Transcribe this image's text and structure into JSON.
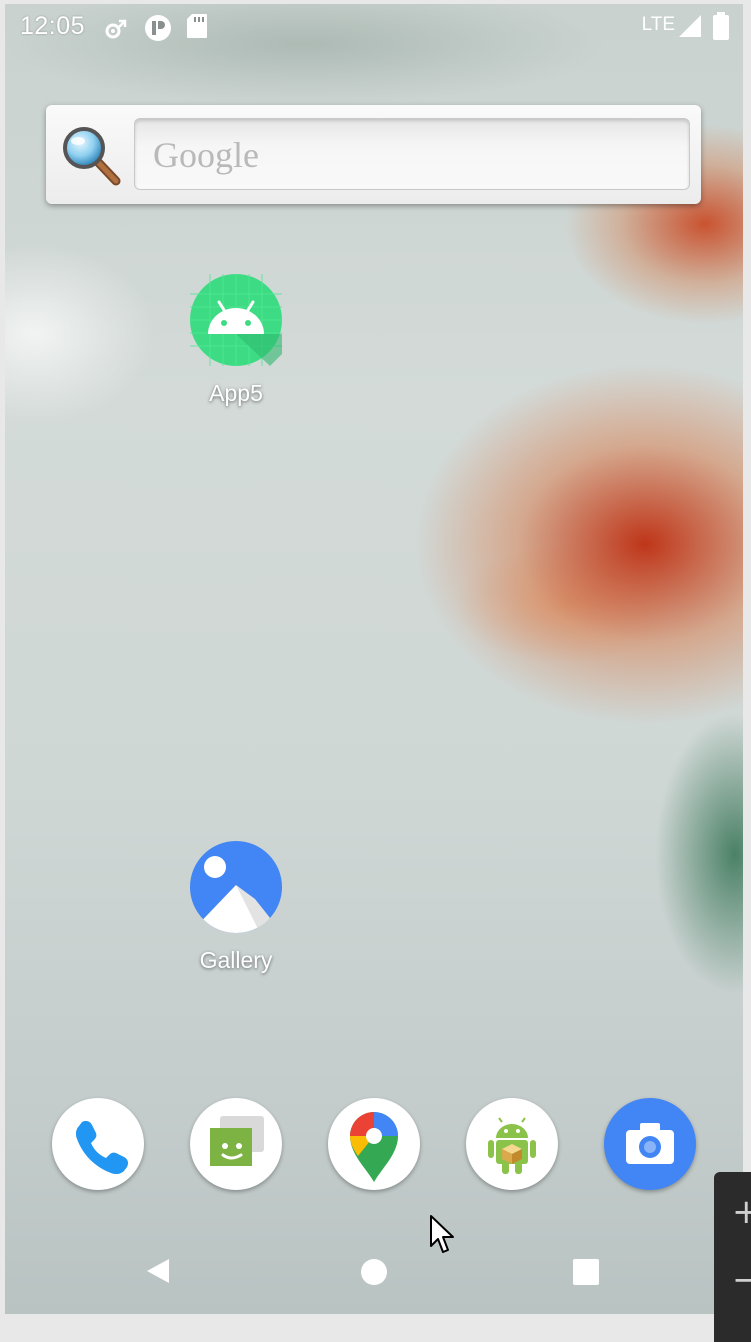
{
  "status_bar": {
    "time": "12:05",
    "left_icons": [
      "settings-sync-icon",
      "privacy-indicator-icon",
      "sd-card-icon"
    ],
    "network_label": "LTE",
    "right_icons": [
      "signal-icon",
      "battery-icon"
    ]
  },
  "search_widget": {
    "placeholder": "Google",
    "icon": "magnifier-icon"
  },
  "desktop_apps": [
    {
      "label": "App5",
      "icon": "android-app-icon",
      "color": "#3ddc84"
    },
    {
      "label": "Gallery",
      "icon": "gallery-icon",
      "color": "#4285f4"
    }
  ],
  "dock": [
    {
      "name": "phone",
      "icon": "phone-icon",
      "color": "#2196f3"
    },
    {
      "name": "messages",
      "icon": "messages-icon",
      "color": "#7cb342"
    },
    {
      "name": "maps",
      "icon": "maps-icon",
      "color": "#ea4335"
    },
    {
      "name": "app-store",
      "icon": "android-store-icon",
      "color": "#8bc34a"
    },
    {
      "name": "camera",
      "icon": "camera-icon",
      "color": "#4285f4"
    }
  ],
  "nav_bar": {
    "buttons": [
      "back-icon",
      "home-icon",
      "recents-icon"
    ]
  },
  "emulator_zoom": {
    "plus": "+",
    "minus": "−"
  }
}
